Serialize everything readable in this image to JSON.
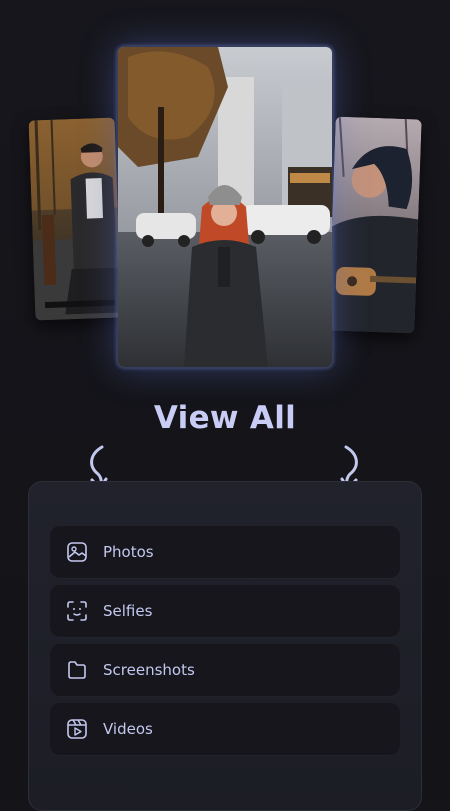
{
  "hero": {
    "title": "View All"
  },
  "photos": {
    "left": "person-seated-outdoors-photo",
    "center": "woman-red-hair-street-photo",
    "right": "man-beanie-guitar-photo"
  },
  "categories": [
    {
      "label": "Photos",
      "icon": "image-icon"
    },
    {
      "label": "Selfies",
      "icon": "face-scan-icon"
    },
    {
      "label": "Screenshots",
      "icon": "folder-icon"
    },
    {
      "label": "Videos",
      "icon": "video-clapper-icon"
    }
  ],
  "colors": {
    "background": "#141419",
    "panel": "#1e1f28",
    "row": "#16161c",
    "accent": "#c9cdf6",
    "icon": "#c3c8ef"
  }
}
